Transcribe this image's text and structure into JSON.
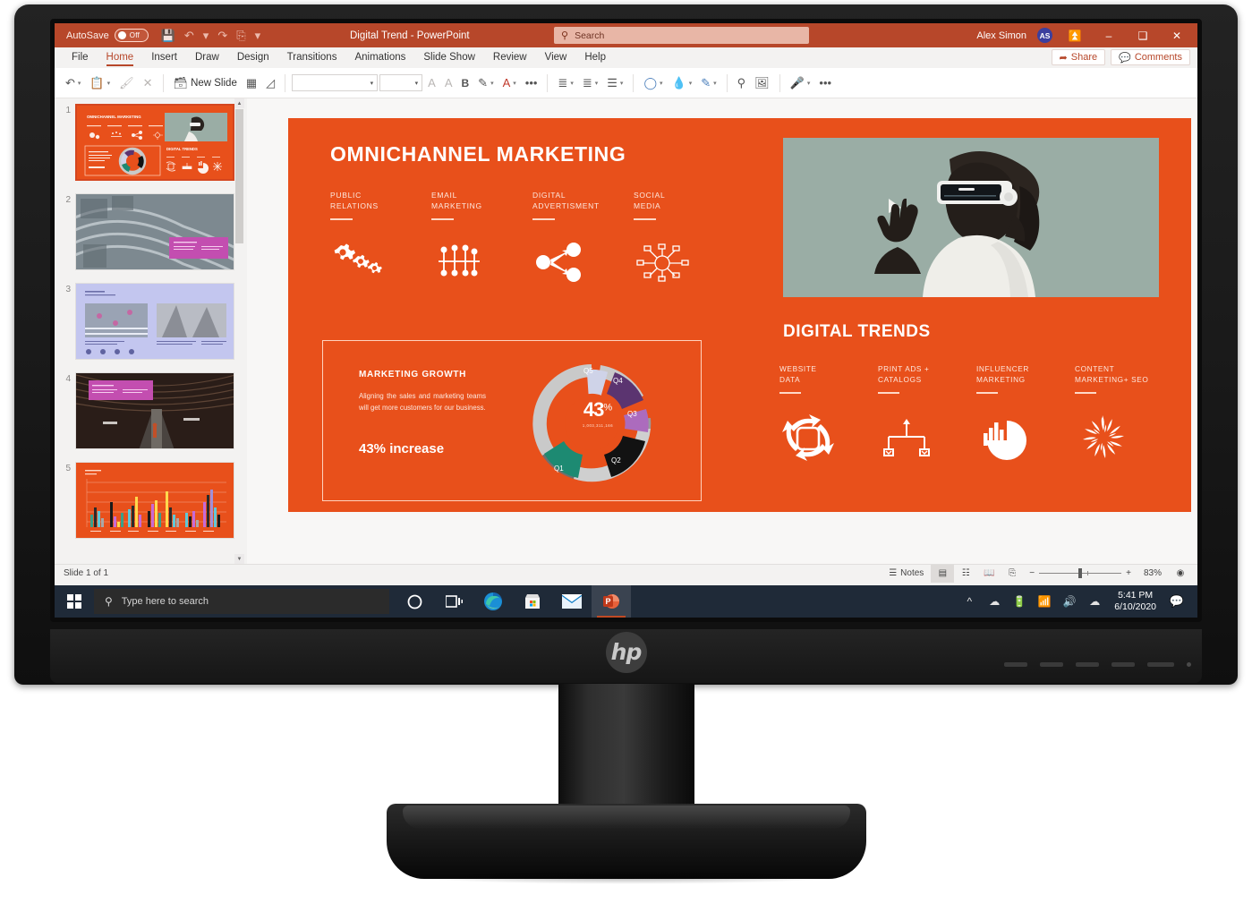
{
  "titlebar": {
    "autosave_label": "AutoSave",
    "autosave_state": "Off",
    "document_title": "Digital Trend - PowerPoint",
    "qat": [
      "save-icon",
      "undo-icon",
      "redo-icon",
      "present-icon",
      "customize-qat-icon"
    ],
    "user_name": "Alex Simon",
    "avatar_initials": "AS",
    "ribbon_display_icon": "ribbon-display-options",
    "minimize": "–",
    "maximize": "❑",
    "close": "✕"
  },
  "search": {
    "placeholder": "Search",
    "icon": "search-icon"
  },
  "tabs": [
    {
      "label": "File",
      "active": false
    },
    {
      "label": "Home",
      "active": true
    },
    {
      "label": "Insert",
      "active": false
    },
    {
      "label": "Draw",
      "active": false
    },
    {
      "label": "Design",
      "active": false
    },
    {
      "label": "Transitions",
      "active": false
    },
    {
      "label": "Animations",
      "active": false
    },
    {
      "label": "Slide Show",
      "active": false
    },
    {
      "label": "Review",
      "active": false
    },
    {
      "label": "View",
      "active": false
    },
    {
      "label": "Help",
      "active": false
    }
  ],
  "tab_actions": {
    "share_label": "Share",
    "comments_label": "Comments"
  },
  "ribbon": {
    "undo": "Undo",
    "paste": "Paste",
    "format_painter": "Format Painter",
    "cut": "Cut",
    "new_slide_label": "New Slide",
    "layout": "Layout",
    "reset": "Reset",
    "font_name": "",
    "font_size": "",
    "increase_font": "A",
    "decrease_font": "A",
    "bold": "B",
    "highlight": "Text Highlight Color",
    "font_color": "A",
    "more_font": "•••",
    "bullets": "Bullets",
    "numbering": "Numbering",
    "align": "Align",
    "shapes": "Shapes",
    "shape_fill": "Shape Fill",
    "shape_outline": "Shape Outline",
    "find": "Find",
    "designer": "Designer",
    "dictate": "Dictate",
    "more": "•••"
  },
  "thumbnails": [
    {
      "number": "1",
      "selected": true,
      "kind": "omnichannel-marketing"
    },
    {
      "number": "2",
      "selected": false,
      "kind": "highway-photo"
    },
    {
      "number": "3",
      "selected": false,
      "kind": "lavender-two-photo"
    },
    {
      "number": "4",
      "selected": false,
      "kind": "tunnel-photo"
    },
    {
      "number": "5",
      "selected": false,
      "kind": "orange-bar-chart"
    }
  ],
  "slide": {
    "title": "OMNICHANNEL MARKETING",
    "categories": [
      {
        "line1": "PUBLIC",
        "line2": "RELATIONS",
        "icon": "gears-icon"
      },
      {
        "line1": "EMAIL",
        "line2": "MARKETING",
        "icon": "network-nodes-icon"
      },
      {
        "line1": "DIGITAL",
        "line2": "ADVERTISMENT",
        "icon": "share-nodes-icon"
      },
      {
        "line1": "SOCIAL",
        "line2": "MEDIA",
        "icon": "hub-diagram-icon"
      }
    ],
    "hero_image_alt": "woman-wearing-vr-headset-illustration",
    "growth": {
      "heading": "MARKETING GROWTH",
      "paragraph": "Aligning the sales and marketing teams will get more customers for our business.",
      "highlight": "43% increase"
    },
    "digital_trends": {
      "title": "DIGITAL TRENDS",
      "categories": [
        {
          "line1": "WEBSITE",
          "line2": "DATA",
          "icon": "refresh-square-icon"
        },
        {
          "line1": "PRINT ADS +",
          "line2": "CATALOGS",
          "icon": "hierarchy-icon"
        },
        {
          "line1": "INFLUENCER",
          "line2": "MARKETING",
          "icon": "pie-bar-chart-icon"
        },
        {
          "line1": "CONTENT",
          "line2": "MARKETING+ SEO",
          "icon": "burst-icon"
        }
      ]
    }
  },
  "chart_data": {
    "type": "pie",
    "title": "MARKETING GROWTH",
    "center_label": "43",
    "center_unit": "%",
    "center_sub": "1,003,311,166",
    "annotation": "43% increase",
    "labels": [
      "Q1",
      "Q2",
      "Q3",
      "Q4",
      "Q5"
    ],
    "values": [
      14,
      24,
      11,
      10,
      9
    ],
    "colors": [
      "#1d8a72",
      "#121212",
      "#ac6bbd",
      "#5b3470",
      "#cfd3e8"
    ],
    "ring_color": "#c9c9c9",
    "ring_color_dark": "#6f6f6f",
    "legend_position": "on-slice",
    "grid": false
  },
  "statusbar": {
    "slide_counter": "Slide 1 of 1",
    "notes_label": "Notes",
    "views": [
      "normal-view",
      "slide-sorter-view",
      "reading-view",
      "slide-show-view"
    ],
    "zoom_minus": "−",
    "zoom_plus": "+",
    "zoom_level": "83%",
    "fit_icon": "fit-to-window-icon"
  },
  "taskbar": {
    "start_icon": "windows-start-icon",
    "search_placeholder": "Type here to search",
    "search_icon": "search-icon",
    "apps": [
      {
        "name": "cortana-icon"
      },
      {
        "name": "task-view-icon"
      },
      {
        "name": "microsoft-edge-icon"
      },
      {
        "name": "microsoft-store-icon"
      },
      {
        "name": "mail-icon"
      },
      {
        "name": "powerpoint-icon",
        "active": true
      }
    ],
    "tray": [
      "show-hidden-icons",
      "network-disconnected-icon",
      "battery-icon",
      "wifi-icon",
      "volume-icon",
      "onedrive-icon"
    ],
    "time": "5:41 PM",
    "date": "6/10/2020",
    "notification_icon": "action-center-icon"
  },
  "hardware": {
    "brand": "hp"
  }
}
